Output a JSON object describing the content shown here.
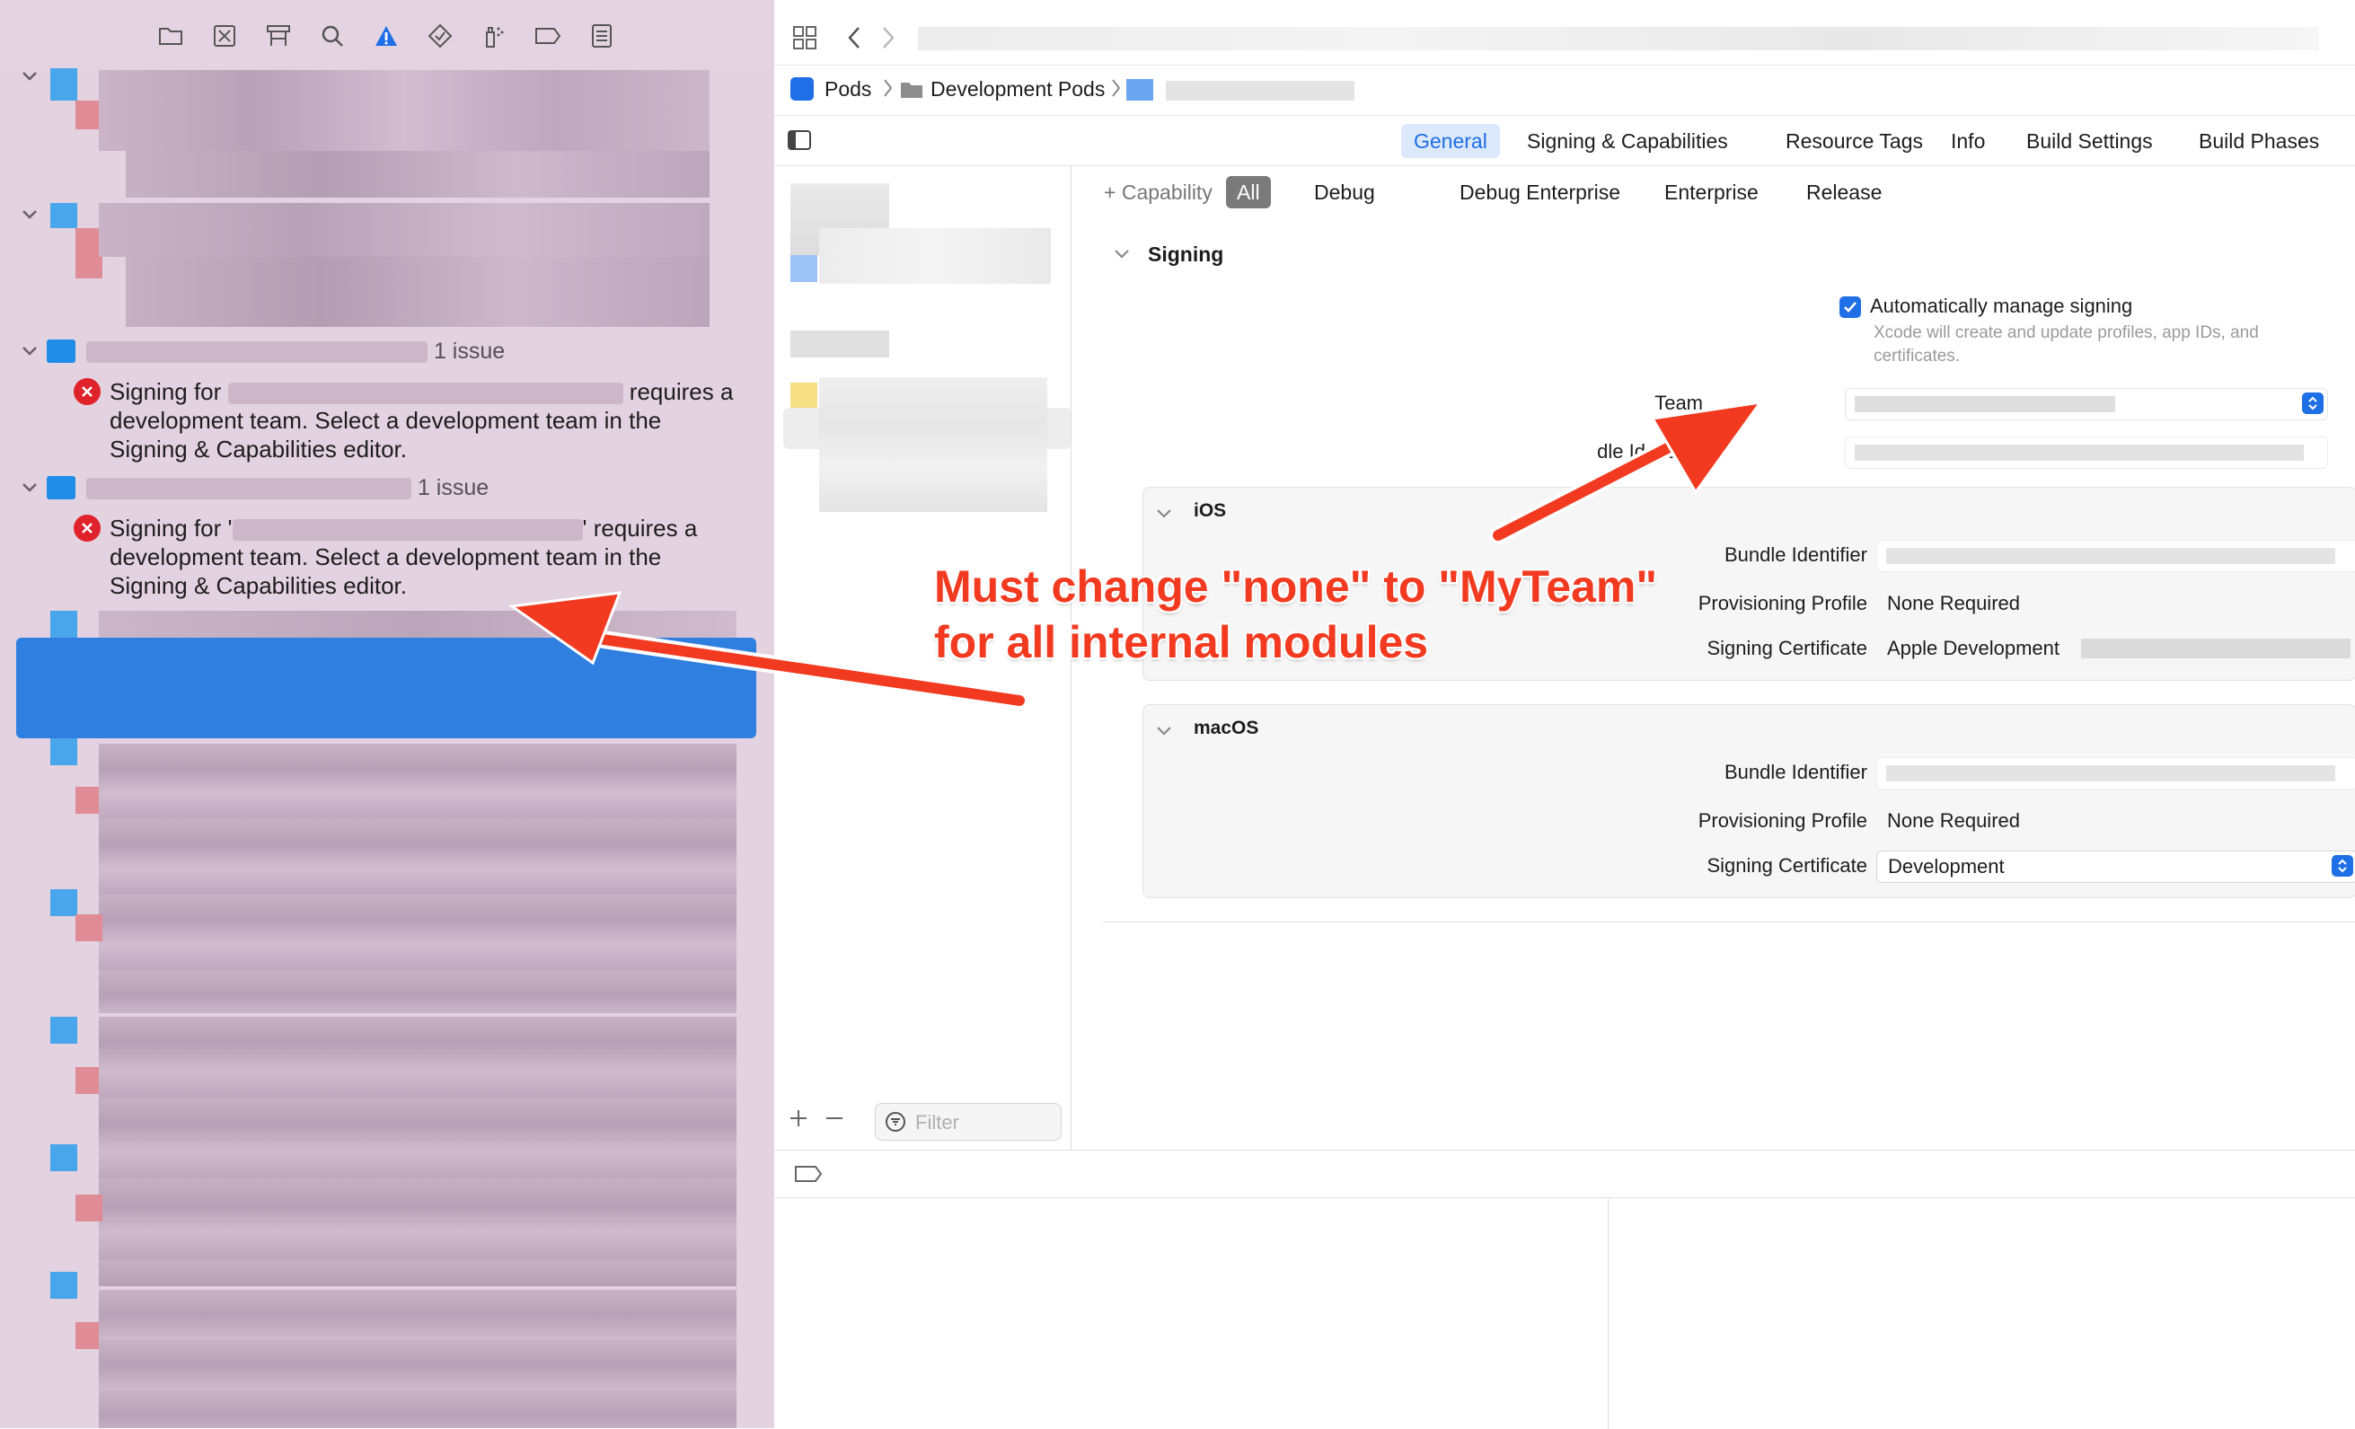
{
  "navigator": {
    "groups": [
      {
        "count_label": "1 issue",
        "message_parts": [
          "Signing for",
          "requires a"
        ],
        "message_line2": "development team. Select a development team in the",
        "message_line3": "Signing & Capabilities editor."
      },
      {
        "count_label": "1 issue",
        "message_parts": [
          "Signing for '",
          "' requires a"
        ],
        "message_line2": "development team. Select a development team in the",
        "message_line3": "Signing & Capabilities editor."
      }
    ]
  },
  "breadcrumb": {
    "item1": "Pods",
    "item2": "Development Pods"
  },
  "tabs": {
    "general": "General",
    "signing": "Signing & Capabilities",
    "resource_tags": "Resource Tags",
    "info": "Info",
    "build_settings": "Build Settings",
    "build_phases": "Build Phases"
  },
  "capability_bar": {
    "add_capability": "Capability",
    "all": "All",
    "debug": "Debug",
    "debug_enterprise": "Debug Enterprise",
    "enterprise": "Enterprise",
    "release": "Release"
  },
  "signing": {
    "title": "Signing",
    "auto_manage_label": "Automatically manage signing",
    "auto_manage_desc_1": "Xcode will create and update profiles, app IDs, and",
    "auto_manage_desc_2": "certificates.",
    "team_label": "Team",
    "bundle_id_label": "dle Identifier",
    "ios": {
      "title": "iOS",
      "bundle_id_label": "Bundle Identifier",
      "prov_profile_label": "Provisioning Profile",
      "prov_profile_value": "None Required",
      "cert_label": "Signing Certificate",
      "cert_value": "Apple Development"
    },
    "macos": {
      "title": "macOS",
      "bundle_id_label": "Bundle Identifier",
      "prov_profile_label": "Provisioning Profile",
      "prov_profile_value": "None Required",
      "cert_label": "Signing Certificate",
      "cert_value": "Development"
    }
  },
  "targets_list": {
    "filter_placeholder": "Filter"
  },
  "annotation": {
    "line1": "Must change \"none\" to \"MyTeam\"",
    "line2": "for all internal modules"
  },
  "colors": {
    "accent": "#1f6fe6",
    "error": "#e0222b",
    "annotation": "#f23a20",
    "selection": "#2f7fe0"
  }
}
